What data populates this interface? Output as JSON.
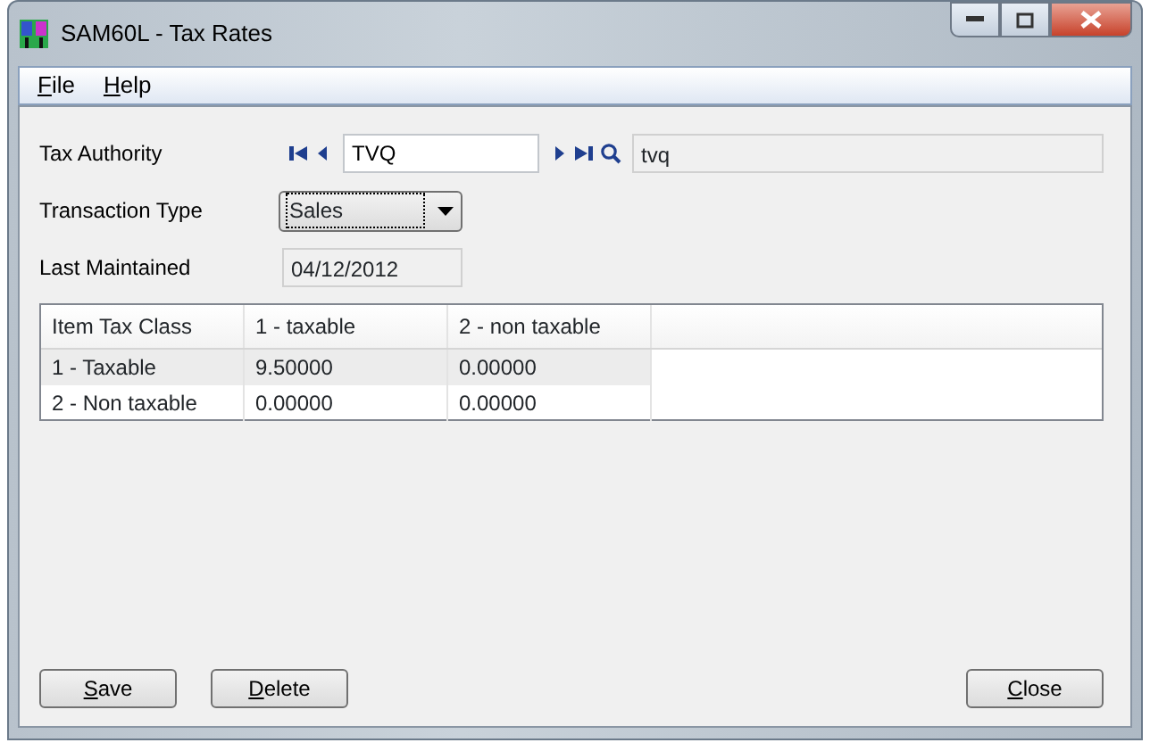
{
  "window": {
    "title": "SAM60L - Tax Rates"
  },
  "menu": [
    "File",
    "Help"
  ],
  "tax_authority": {
    "label": "Tax Authority",
    "value": "TVQ",
    "description": "tvq"
  },
  "transaction_type": {
    "label": "Transaction Type",
    "value": "Sales"
  },
  "last_maintained": {
    "label": "Last Maintained",
    "value": "04/12/2012"
  },
  "table": {
    "columns": [
      "Item Tax Class",
      "1 - taxable",
      "2 - non taxable"
    ],
    "rows": [
      {
        "cells": [
          "1 - Taxable",
          "9.50000",
          "0.00000"
        ],
        "selected": true
      },
      {
        "cells": [
          "2 - Non taxable",
          "0.00000",
          "0.00000"
        ],
        "selected": false
      }
    ]
  },
  "buttons": [
    "Save",
    "Delete",
    "Close"
  ]
}
